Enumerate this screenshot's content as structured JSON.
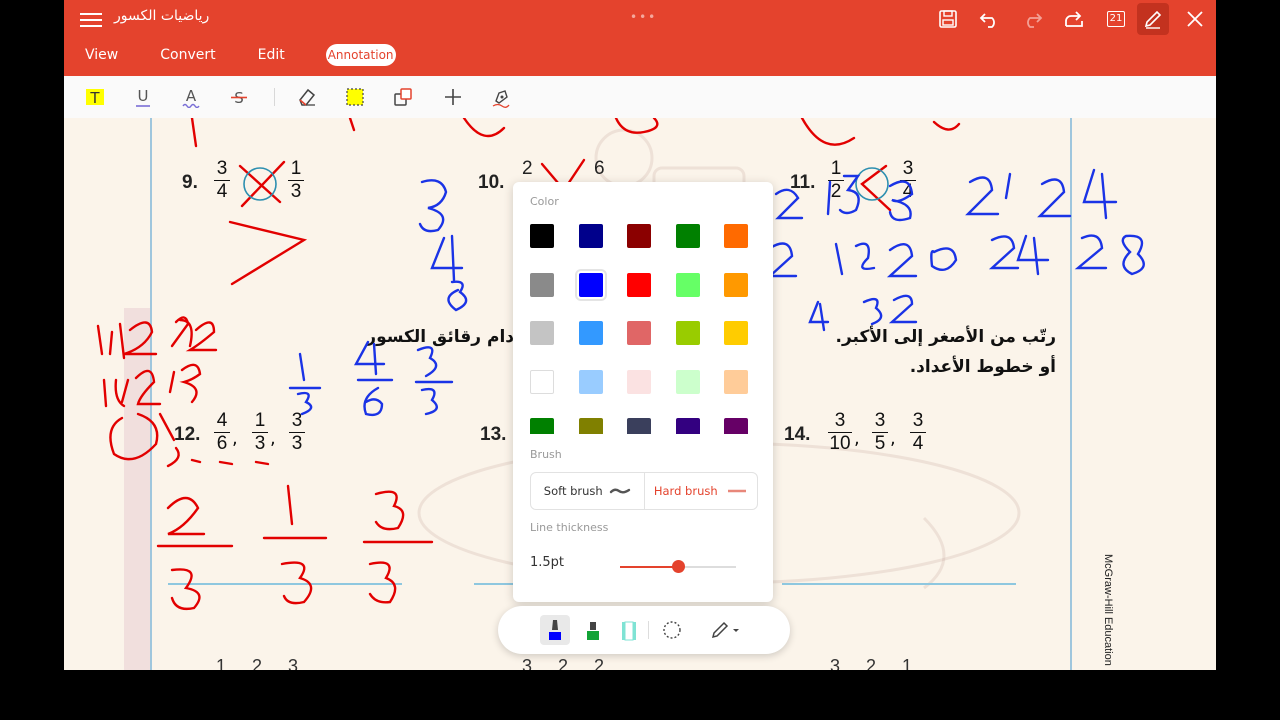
{
  "app": {
    "doc_title": "رياضيات الكسور",
    "page_badge": "21",
    "tabs": [
      {
        "label": "View"
      },
      {
        "label": "Convert"
      },
      {
        "label": "Edit"
      },
      {
        "label": "Annotation",
        "active": true
      }
    ],
    "toolbar_icons": [
      "save-icon",
      "undo-icon",
      "redo-icon",
      "share-icon",
      "page-count-icon",
      "annotate-pen-icon",
      "close-icon"
    ],
    "accent_color": "#e4432d"
  },
  "annotation_tools": [
    {
      "icon": "text-highlight-icon",
      "glyph": "T"
    },
    {
      "icon": "underline-icon",
      "glyph": "U"
    },
    {
      "icon": "squiggly-underline-icon",
      "glyph": "A"
    },
    {
      "icon": "strikethrough-icon",
      "glyph": "S"
    },
    {
      "icon": "eraser-icon"
    },
    {
      "icon": "area-highlight-icon"
    },
    {
      "icon": "shape-icon"
    },
    {
      "icon": "add-icon"
    },
    {
      "icon": "signature-pen-icon"
    }
  ],
  "document": {
    "problems": [
      {
        "number": "9.",
        "fractions": [
          [
            "3",
            "4"
          ],
          [
            "1",
            "3"
          ]
        ]
      },
      {
        "number": "10.",
        "values": [
          "2",
          "6"
        ]
      },
      {
        "number": "11.",
        "fractions": [
          [
            "1",
            "2"
          ],
          [
            "3",
            "4"
          ]
        ]
      },
      {
        "number": "12.",
        "fractions": [
          [
            "4",
            "6"
          ],
          [
            "1",
            "3"
          ],
          [
            "3",
            "3"
          ]
        ]
      },
      {
        "number": "13."
      },
      {
        "number": "14.",
        "fractions": [
          [
            "3",
            "10"
          ],
          [
            "3",
            "5"
          ],
          [
            "3",
            "4"
          ]
        ]
      }
    ],
    "instruction_line1": "رتّب من الأصغر إلى الأكبر.",
    "instruction_line1_end": "دام رقائق الكسور",
    "instruction_line2": "أو خطوط الأعداد.",
    "publisher": "McGraw-Hill Education",
    "bottom_numbers": [
      "1",
      "2",
      "3",
      "3",
      "2",
      "2",
      "3",
      "2",
      "1"
    ],
    "handwriting": [
      "1,4 2 , 2",
      "1,6 , 2 , 3",
      "15 18 21 24",
      "2 16 20 24 28",
      "4 32",
      "2/3",
      "1/3",
      "3/3"
    ]
  },
  "color_panel": {
    "color_label": "Color",
    "colors": [
      "#000000",
      "#00008b",
      "#8b0000",
      "#008000",
      "#ff6a00",
      "#8a8a8a",
      "#0000ff",
      "#ff0000",
      "#66ff66",
      "#ff9900",
      "#c4c4c4",
      "#3399ff",
      "#e06666",
      "#99cc00",
      "#ffcc00",
      "#ffffff",
      "#99ccff",
      "#fbe2e2",
      "#ccffcc",
      "#ffcc99",
      "#008000",
      "#808000",
      "#3a3f5c",
      "#330080",
      "#660066"
    ],
    "selected_color": "#0000ff",
    "brush_label": "Brush",
    "soft_brush": "Soft brush",
    "hard_brush": "Hard brush",
    "thickness_label": "Line thickness",
    "thickness_value": "1.5pt",
    "thickness_level": 0.5
  },
  "pen_bar": {
    "tools": [
      "blue-marker-icon",
      "green-highlighter-icon",
      "teal-highlighter-icon",
      "lasso-select-icon",
      "pen-settings-icon"
    ],
    "active_tool": "blue-marker-icon"
  }
}
